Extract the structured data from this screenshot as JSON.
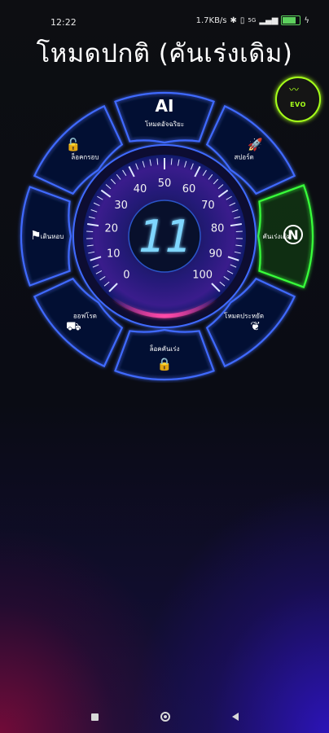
{
  "status_bar": {
    "time": "12:22",
    "network_speed": "1.7KB/s",
    "signal_label": "5G",
    "icons": [
      "bluetooth-icon",
      "vibrate-icon",
      "signal-icon",
      "battery-icon",
      "charging-icon"
    ]
  },
  "title": "โหมดปกติ (คันเร่งเดิม)",
  "gauge": {
    "current_value": "11",
    "ticks": [
      "0",
      "10",
      "20",
      "30",
      "40",
      "50",
      "60",
      "70",
      "80",
      "90",
      "100"
    ],
    "needle_value": 0
  },
  "modes": [
    {
      "id": "ai",
      "big": "AI",
      "label": "โหมดอัจฉริยะ",
      "icon": "ai-icon",
      "active": false
    },
    {
      "id": "sport",
      "label": "สปอร์ต",
      "icon": "rocket-icon",
      "active": false
    },
    {
      "id": "normal",
      "big": "N",
      "label": "คันเร่งเดิม",
      "icon": "n-letter-icon",
      "active": true
    },
    {
      "id": "eco",
      "label": "โหมดประหยัด",
      "icon": "leaf-icon",
      "active": false
    },
    {
      "id": "lock",
      "label": "ล็อคคันเร่ง",
      "icon": "hand-lock-icon",
      "active": false
    },
    {
      "id": "tow",
      "label": "ออฟโรด",
      "icon": "tow-truck-icon",
      "active": false
    },
    {
      "id": "walk",
      "label": "เดินหอบ",
      "icon": "walking-icon",
      "active": false
    },
    {
      "id": "lockdoor",
      "label": "ล็อคกรอบ",
      "icon": "car-lock-icon",
      "active": false
    }
  ],
  "colors": {
    "ring_blue": "#3f6bff",
    "active_green": "#39ff3a",
    "logo_green": "#a6ff1a",
    "gauge_pink": "#ff3b9a"
  }
}
